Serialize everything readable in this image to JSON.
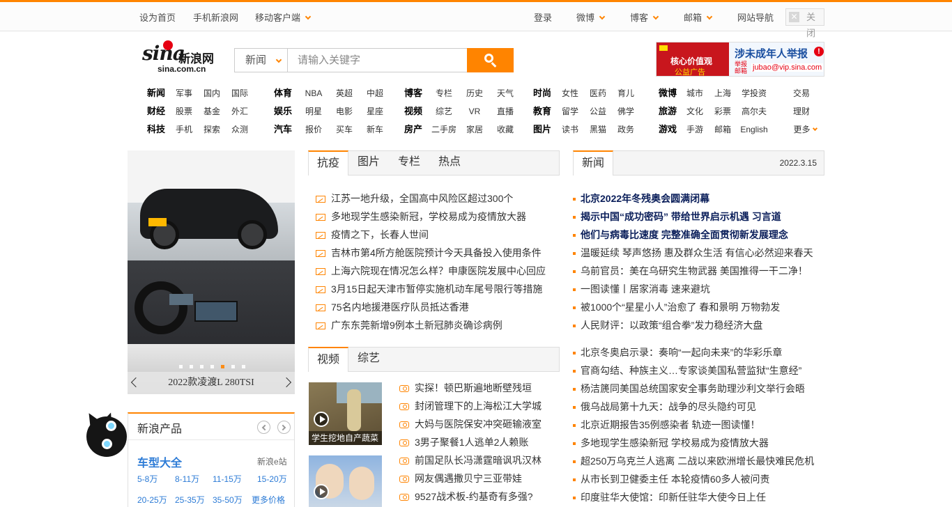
{
  "topbar": {
    "left": [
      "设为首页",
      "手机新浪网",
      "移动客户端"
    ],
    "right": [
      "登录",
      "微博",
      "博客",
      "邮箱",
      "网站导航"
    ],
    "close": "关闭"
  },
  "logo": {
    "brand": "sina",
    "name": "新浪网",
    "domain": "sina.com.cn"
  },
  "search": {
    "scope": "新闻",
    "placeholder": "请输入关键字"
  },
  "ad": {
    "left_line1": "核心价值观",
    "left_line2": "公益广告",
    "headline": "涉未成年人举报",
    "sub": "举报邮箱",
    "email": "jubao@vip.sina.com"
  },
  "nav": {
    "groups": [
      [
        [
          "新闻",
          "军事",
          "国内",
          "国际"
        ],
        [
          "财经",
          "股票",
          "基金",
          "外汇"
        ],
        [
          "科技",
          "手机",
          "探索",
          "众测"
        ]
      ],
      [
        [
          "体育",
          "NBA",
          "英超",
          "中超"
        ],
        [
          "娱乐",
          "明星",
          "电影",
          "星座"
        ],
        [
          "汽车",
          "报价",
          "买车",
          "新车"
        ]
      ],
      [
        [
          "博客",
          "专栏",
          "历史",
          "天气"
        ],
        [
          "视频",
          "综艺",
          "VR",
          "直播"
        ],
        [
          "房产",
          "二手房",
          "家居",
          "收藏"
        ]
      ],
      [
        [
          "时尚",
          "女性",
          "医药",
          "育儿"
        ],
        [
          "教育",
          "留学",
          "公益",
          "佛学"
        ],
        [
          "图片",
          "读书",
          "黑猫",
          "政务"
        ]
      ],
      [
        [
          "微博",
          "城市",
          "上海",
          "学投资"
        ],
        [
          "旅游",
          "文化",
          "彩票",
          "高尔夫"
        ],
        [
          "游戏",
          "手游",
          "邮箱",
          "English"
        ]
      ],
      [
        [
          "交易"
        ],
        [
          "理财"
        ],
        [
          "更多"
        ]
      ]
    ]
  },
  "slider": {
    "caption": "2022款凌渡L 280TSI",
    "slide_count": 7,
    "active_slide": 5
  },
  "products": {
    "title": "新浪产品",
    "category": "车型大全",
    "site": "新浪e站",
    "row1": [
      "5-8万",
      "8-11万",
      "11-15万",
      "15-20万"
    ],
    "row2": [
      "20-25万",
      "25-35万",
      "35-50万",
      "更多价格"
    ]
  },
  "center": {
    "tabs": [
      "抗疫",
      "图片",
      "专栏",
      "热点"
    ],
    "news": [
      "江苏一地升级，全国高中风险区超过300个",
      "多地现学生感染新冠，学校易成为疫情放大器",
      "疫情之下，长春人世间",
      "吉林市第4所方舱医院预计今天具备投入使用条件",
      "上海六院现在情况怎么样？申康医院发展中心回应",
      "3月15日起天津市暂停实施机动车尾号限行等措施",
      "75名内地援港医疗队员抵达香港",
      "广东东莞新增9例本土新冠肺炎确诊病例"
    ],
    "video_tabs": [
      "视频",
      "综艺"
    ],
    "video_caption": "学生挖地自产蔬菜",
    "videos": [
      "实探！顿巴斯遍地断壁残垣",
      "封闭管理下的上海松江大学城",
      "大妈与医院保安冲突砸输液室",
      "3男子聚餐1人逃单2人赖账",
      "前国足队长冯潇霆暗讽巩汉林",
      "网友偶遇撒贝宁三亚带娃",
      "9527战术板-约基奇有多强?"
    ]
  },
  "right": {
    "tab": "新闻",
    "date": "2022.3.15",
    "headlines": [
      "北京2022年冬残奥会圆满闭幕",
      "揭示中国“成功密码” 带给世界启示机遇 习言道",
      "他们与病毒比速度 完整准确全面贯彻新发展理念"
    ],
    "news1": [
      "温暖延续 琴声悠扬 惠及群众生活 有信心必然迎来春天",
      "乌前官员：美在乌研究生物武器 美国推得一干二净！",
      "一图读懂丨居家消毒 速来避坑",
      "被1000个“星星小人”治愈了 春和景明 万物勃发",
      "人民财评：以政策“组合拳”发力稳经济大盘"
    ],
    "news2": [
      "北京冬奥启示录：奏响“一起向未来”的华彩乐章",
      "官商勾结、种族主义…专家谈美国私营监狱“生意经”",
      "杨洁篪同美国总统国家安全事务助理沙利文举行会晤",
      "俄乌战局第十九天：战争的尽头隐约可见",
      "北京近期报告35例感染者 轨迹一图读懂！",
      "多地现学生感染新冠 学校易成为疫情放大器",
      "超250万乌克兰人逃离 二战以来欧洲增长最快难民危机",
      "从市长到卫健委主任 本轮疫情60多人被问责",
      "印度驻华大使馆：印新任驻华大使今日上任"
    ]
  }
}
